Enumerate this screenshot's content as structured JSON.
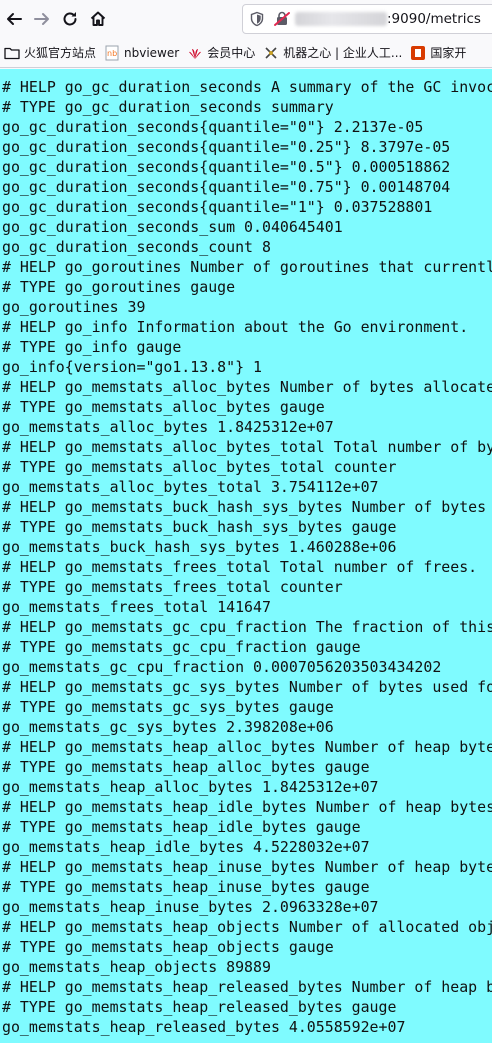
{
  "browser": {
    "url_path": ":9090/metrics"
  },
  "bookmarks": [
    {
      "label": "火狐官方站点",
      "icon": "folder-icon"
    },
    {
      "label": "nbviewer",
      "icon": "nbviewer-icon"
    },
    {
      "label": "会员中心",
      "icon": "huawei-icon"
    },
    {
      "label": "机器之心 | 企业人工...",
      "icon": "jiqizhixin-icon"
    },
    {
      "label": "国家开",
      "icon": "office-icon"
    }
  ],
  "metrics_lines": [
    "# HELP go_gc_duration_seconds A summary of the GC invocation durations.",
    "# TYPE go_gc_duration_seconds summary",
    "go_gc_duration_seconds{quantile=\"0\"} 2.2137e-05",
    "go_gc_duration_seconds{quantile=\"0.25\"} 8.3797e-05",
    "go_gc_duration_seconds{quantile=\"0.5\"} 0.000518862",
    "go_gc_duration_seconds{quantile=\"0.75\"} 0.00148704",
    "go_gc_duration_seconds{quantile=\"1\"} 0.037528801",
    "go_gc_duration_seconds_sum 0.040645401",
    "go_gc_duration_seconds_count 8",
    "# HELP go_goroutines Number of goroutines that currently exist.",
    "# TYPE go_goroutines gauge",
    "go_goroutines 39",
    "# HELP go_info Information about the Go environment.",
    "# TYPE go_info gauge",
    "go_info{version=\"go1.13.8\"} 1",
    "# HELP go_memstats_alloc_bytes Number of bytes allocated and still in use.",
    "# TYPE go_memstats_alloc_bytes gauge",
    "go_memstats_alloc_bytes 1.8425312e+07",
    "# HELP go_memstats_alloc_bytes_total Total number of bytes allocated, even if freed.",
    "# TYPE go_memstats_alloc_bytes_total counter",
    "go_memstats_alloc_bytes_total 3.754112e+07",
    "# HELP go_memstats_buck_hash_sys_bytes Number of bytes used by the profiling bucket hash table.",
    "# TYPE go_memstats_buck_hash_sys_bytes gauge",
    "go_memstats_buck_hash_sys_bytes 1.460288e+06",
    "# HELP go_memstats_frees_total Total number of frees.",
    "# TYPE go_memstats_frees_total counter",
    "go_memstats_frees_total 141647",
    "# HELP go_memstats_gc_cpu_fraction The fraction of this program's available CPU time used by the GC since the program started.",
    "# TYPE go_memstats_gc_cpu_fraction gauge",
    "go_memstats_gc_cpu_fraction 0.0007056203503434202",
    "# HELP go_memstats_gc_sys_bytes Number of bytes used for garbage collection system metadata.",
    "# TYPE go_memstats_gc_sys_bytes gauge",
    "go_memstats_gc_sys_bytes 2.398208e+06",
    "# HELP go_memstats_heap_alloc_bytes Number of heap bytes allocated and still in use.",
    "# TYPE go_memstats_heap_alloc_bytes gauge",
    "go_memstats_heap_alloc_bytes 1.8425312e+07",
    "# HELP go_memstats_heap_idle_bytes Number of heap bytes waiting to be used.",
    "# TYPE go_memstats_heap_idle_bytes gauge",
    "go_memstats_heap_idle_bytes 4.5228032e+07",
    "# HELP go_memstats_heap_inuse_bytes Number of heap bytes that are in use.",
    "# TYPE go_memstats_heap_inuse_bytes gauge",
    "go_memstats_heap_inuse_bytes 2.0963328e+07",
    "# HELP go_memstats_heap_objects Number of allocated objects.",
    "# TYPE go_memstats_heap_objects gauge",
    "go_memstats_heap_objects 89889",
    "# HELP go_memstats_heap_released_bytes Number of heap bytes released to OS.",
    "# TYPE go_memstats_heap_released_bytes gauge",
    "go_memstats_heap_released_bytes 4.0558592e+07"
  ],
  "colors": {
    "page_background": "#7ffbff",
    "text": "#111111",
    "toolbar": "#f9f9fb"
  }
}
